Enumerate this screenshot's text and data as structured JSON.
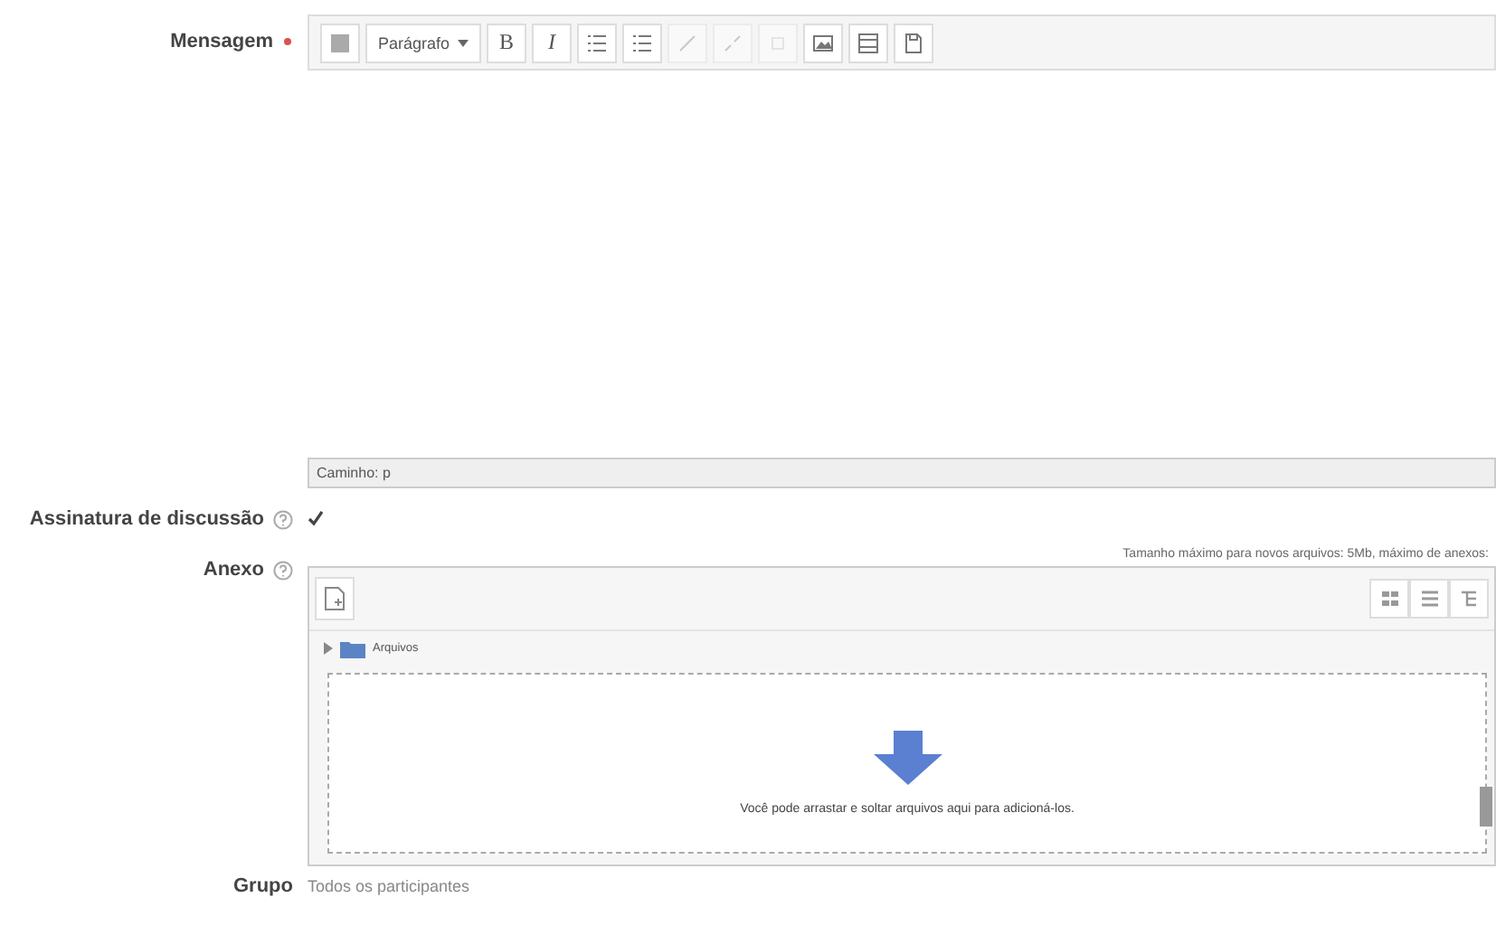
{
  "message": {
    "label": "Mensagem",
    "required": true,
    "toolbar": [
      {
        "kind": "icon",
        "disabled": false
      },
      {
        "kind": "dropdown",
        "text": "Parágrafo",
        "disabled": false
      },
      {
        "kind": "text",
        "text": "B",
        "disabled": false
      },
      {
        "kind": "text",
        "text": "I",
        "disabled": false
      },
      {
        "kind": "icon",
        "disabled": false
      },
      {
        "kind": "icon",
        "disabled": false
      },
      {
        "kind": "icon",
        "disabled": true
      },
      {
        "kind": "icon",
        "disabled": true
      },
      {
        "kind": "icon",
        "disabled": true
      },
      {
        "kind": "icon",
        "disabled": false
      },
      {
        "kind": "icon",
        "disabled": false
      },
      {
        "kind": "icon",
        "disabled": false
      }
    ],
    "path": "Caminho: p"
  },
  "signature": {
    "label": "Assinatura de discussão",
    "checked": true
  },
  "attachment": {
    "label": "Anexo",
    "limits": "Tamanho máximo para novos arquivos: 5Mb, máximo de anexos:",
    "folder": "Arquivos",
    "drop_hint": "Você pode arrastar e soltar arquivos aqui para adicioná-los."
  },
  "group": {
    "label": "Grupo",
    "value": "Todos os participantes"
  }
}
